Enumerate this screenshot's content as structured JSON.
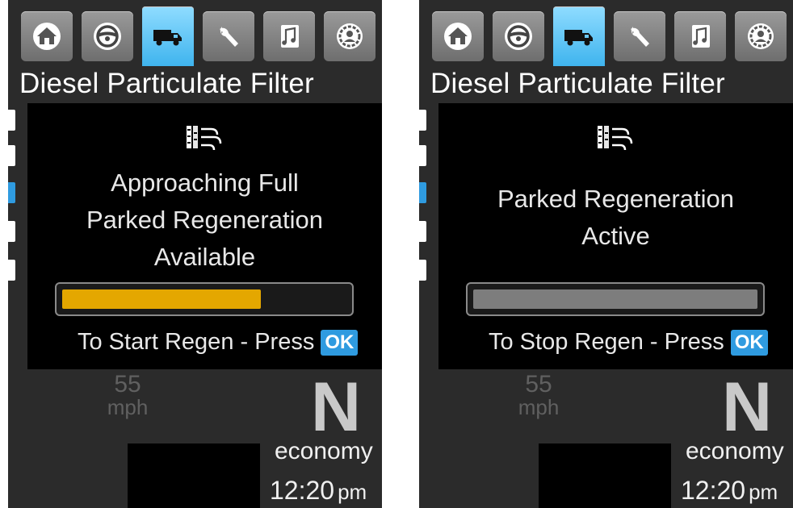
{
  "tab_icons": [
    "home-icon",
    "steering-wheel-icon",
    "truck-icon",
    "wrench-icon",
    "music-note-icon",
    "profile-gear-icon"
  ],
  "active_tab": 2,
  "accent_color": "#2f9be0",
  "screens": [
    {
      "title": "Diesel Particulate Filter",
      "status_lines": [
        "Approaching Full",
        "Parked Regeneration",
        "Available"
      ],
      "progress": 0.7,
      "progress_color": "#e4a700",
      "prompt": "To Start Regen - Press",
      "ok_label": "OK",
      "speed_value": "55",
      "speed_unit": "mph",
      "gear": "N",
      "drive_mode": "economy",
      "time": "12:20",
      "ampm": "pm"
    },
    {
      "title": "Diesel Particulate Filter",
      "status_lines": [
        "Parked Regeneration",
        "Active"
      ],
      "progress": 1.0,
      "progress_color": "#7d7d7d",
      "prompt": "To Stop Regen - Press",
      "ok_label": "OK",
      "speed_value": "55",
      "speed_unit": "mph",
      "gear": "N",
      "drive_mode": "economy",
      "time": "12:20",
      "ampm": "pm"
    }
  ]
}
